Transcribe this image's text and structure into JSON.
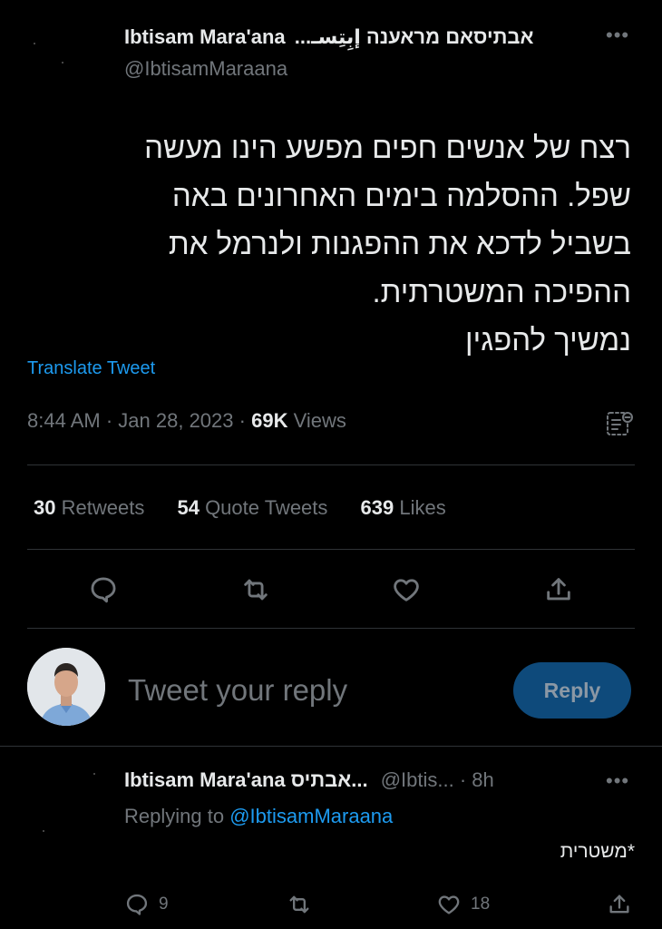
{
  "tweet": {
    "author_name": "Ibtisam Mara'ana",
    "author_name_alt": "...אבתיסאם מראענה إبِتِسـ",
    "handle": "@IbtisamMaraana",
    "more_icon": "more-horizontal-icon",
    "text_lines": [
      "רצח של אנשים חפים מפשע הינו מעשה",
      "שפל. ההסלמה בימים האחרונים באה",
      "בשביל לדכא את ההפגנות ולנרמל את",
      "ההפיכה המשטרתית.",
      "נמשיך להפגין"
    ],
    "translate_label": "Translate Tweet",
    "time": "8:44 AM",
    "date": "Jan 28, 2023",
    "views_count": "69K",
    "views_label": "Views",
    "separator": "·",
    "analytics_icon": "analytics-icon"
  },
  "stats": {
    "retweets_count": "30",
    "retweets_label": "Retweets",
    "quotes_count": "54",
    "quotes_label": "Quote Tweets",
    "likes_count": "639",
    "likes_label": "Likes"
  },
  "actions": {
    "reply_icon": "reply-icon",
    "retweet_icon": "retweet-icon",
    "like_icon": "heart-icon",
    "share_icon": "share-icon"
  },
  "composer": {
    "placeholder": "Tweet your reply",
    "button_label": "Reply",
    "button_color": "#0e4a7b"
  },
  "reply": {
    "author_name": "Ibtisam Mara'ana",
    "author_name_alt": "אבתיס...",
    "handle_truncated": "@Ibtis...",
    "time_ago": "8h",
    "replying_to_label": "Replying to",
    "replying_to_handle": "@IbtisamMaraana",
    "text": "*משטרית",
    "reply_count": "9",
    "like_count": "18"
  },
  "colors": {
    "background": "#000000",
    "text": "#e7e9ea",
    "muted": "#71767b",
    "link": "#1d9bf0",
    "divider": "#2f3336"
  }
}
